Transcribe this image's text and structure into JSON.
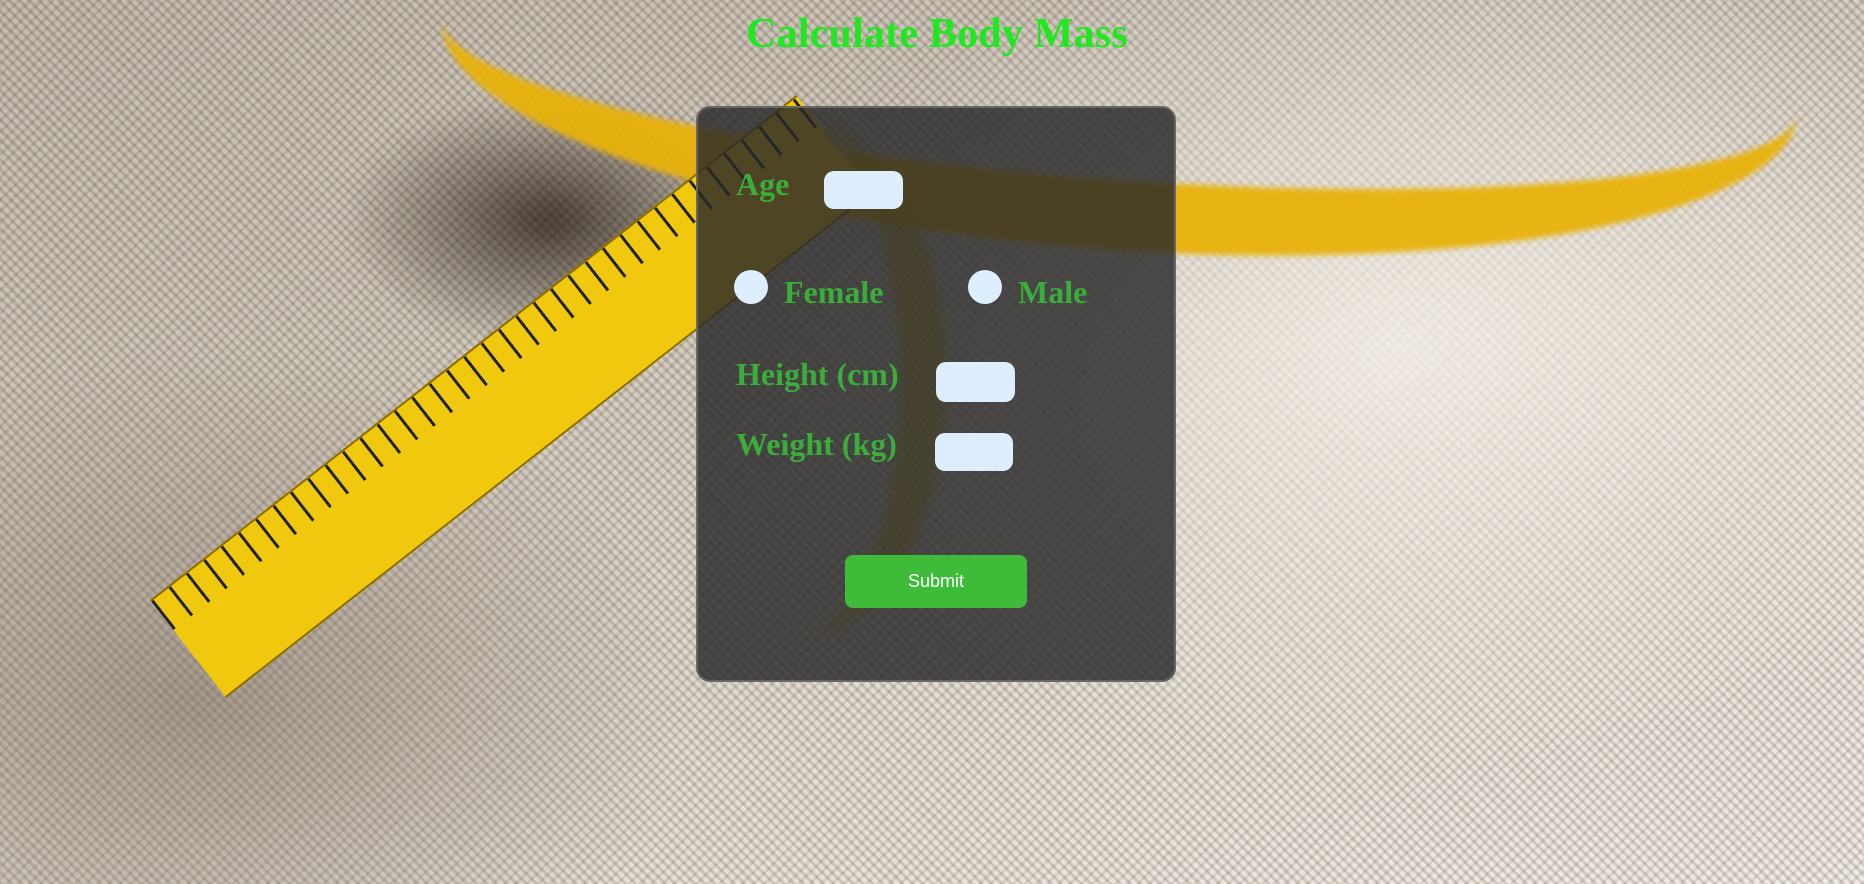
{
  "page": {
    "title": "Calculate Body Mass"
  },
  "form": {
    "age_label": "Age",
    "age_value": "",
    "gender_options": [
      {
        "label": "Female",
        "selected": false
      },
      {
        "label": "Male",
        "selected": false
      }
    ],
    "height_label": "Height (cm)",
    "height_value": "",
    "weight_label": "Weight (kg)",
    "weight_value": "",
    "submit_label": "Submit"
  },
  "colors": {
    "title": "#1ee91e",
    "label": "#3aad3a",
    "input_bg": "#ddeeff",
    "panel_bg": "#282828",
    "button_bg": "#3fbb3a",
    "button_text": "#ffffff"
  },
  "background": {
    "image": "measuring-tape-on-burlap"
  }
}
